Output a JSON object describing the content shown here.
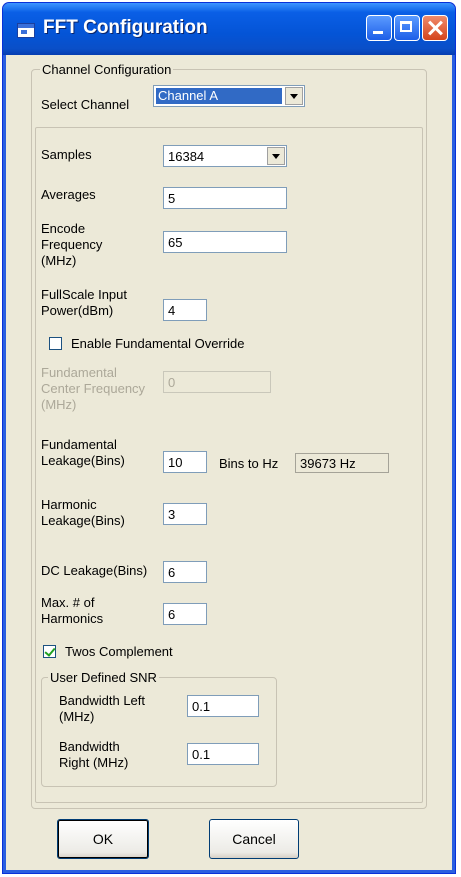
{
  "window": {
    "title": "FFT Configuration"
  },
  "channel_group": {
    "legend": "Channel Configuration",
    "select_label": "Select Channel",
    "selected_channel": "Channel A"
  },
  "fields": {
    "samples_label": "Samples",
    "samples_value": "16384",
    "averages_label": "Averages",
    "averages_value": "5",
    "encode_label_1": "Encode",
    "encode_label_2": "Frequency",
    "encode_label_3": "(MHz)",
    "encode_value": "65",
    "fullscale_label_1": "FullScale Input",
    "fullscale_label_2": "Power(dBm)",
    "fullscale_value": "4",
    "override_label": "Enable Fundamental Override",
    "fund_center_label_1": "Fundamental",
    "fund_center_label_2": "Center Frequency",
    "fund_center_label_3": "(MHz)",
    "fund_center_value": "0",
    "fund_leak_label_1": "Fundamental",
    "fund_leak_label_2": "Leakage(Bins)",
    "fund_leak_value": "10",
    "bins_to_hz_label": "Bins to Hz",
    "bins_to_hz_value": "39673 Hz",
    "harm_leak_label_1": "Harmonic",
    "harm_leak_label_2": "Leakage(Bins)",
    "harm_leak_value": "3",
    "dc_leak_label": "DC Leakage(Bins)",
    "dc_leak_value": "6",
    "max_harm_label_1": "Max. # of",
    "max_harm_label_2": "Harmonics",
    "max_harm_value": "6",
    "twos_label": "Twos Complement"
  },
  "snr_group": {
    "legend": "User Defined SNR",
    "bw_left_label_1": "Bandwidth Left",
    "bw_left_label_2": "(MHz)",
    "bw_left_value": "0.1",
    "bw_right_label_1": "Bandwidth",
    "bw_right_label_2": "Right (MHz)",
    "bw_right_value": "0.1"
  },
  "buttons": {
    "ok": "OK",
    "cancel": "Cancel"
  },
  "colors": {
    "titlebar": "#0454d6",
    "dialog_bg": "#ece9d8",
    "selection": "#316ac5"
  }
}
